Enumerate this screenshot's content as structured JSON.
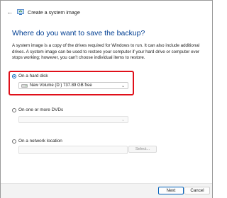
{
  "window": {
    "title": "Create a system image"
  },
  "page": {
    "heading": "Where do you want to save the backup?",
    "description": "A system image is a copy of the drives required for Windows to run. It can also include additional drives. A system image can be used to restore your computer if your hard drive or computer ever stops working; however, you can't choose individual items to restore."
  },
  "options": {
    "hard_disk": {
      "label": "On a hard disk",
      "selected": true,
      "drive_value": "New Volume (D:)  737.89 GB free"
    },
    "dvd": {
      "label": "On one or more DVDs",
      "selected": false
    },
    "network": {
      "label": "On a network location",
      "selected": false,
      "select_label": "Select..."
    }
  },
  "buttons": {
    "next": "Next",
    "cancel": "Cancel"
  },
  "colors": {
    "accent": "#005fb8",
    "heading": "#003e92",
    "highlight": "#e0101a"
  },
  "icons": [
    "back-arrow-icon",
    "system-image-icon",
    "drive-icon",
    "chevron-down-icon"
  ]
}
